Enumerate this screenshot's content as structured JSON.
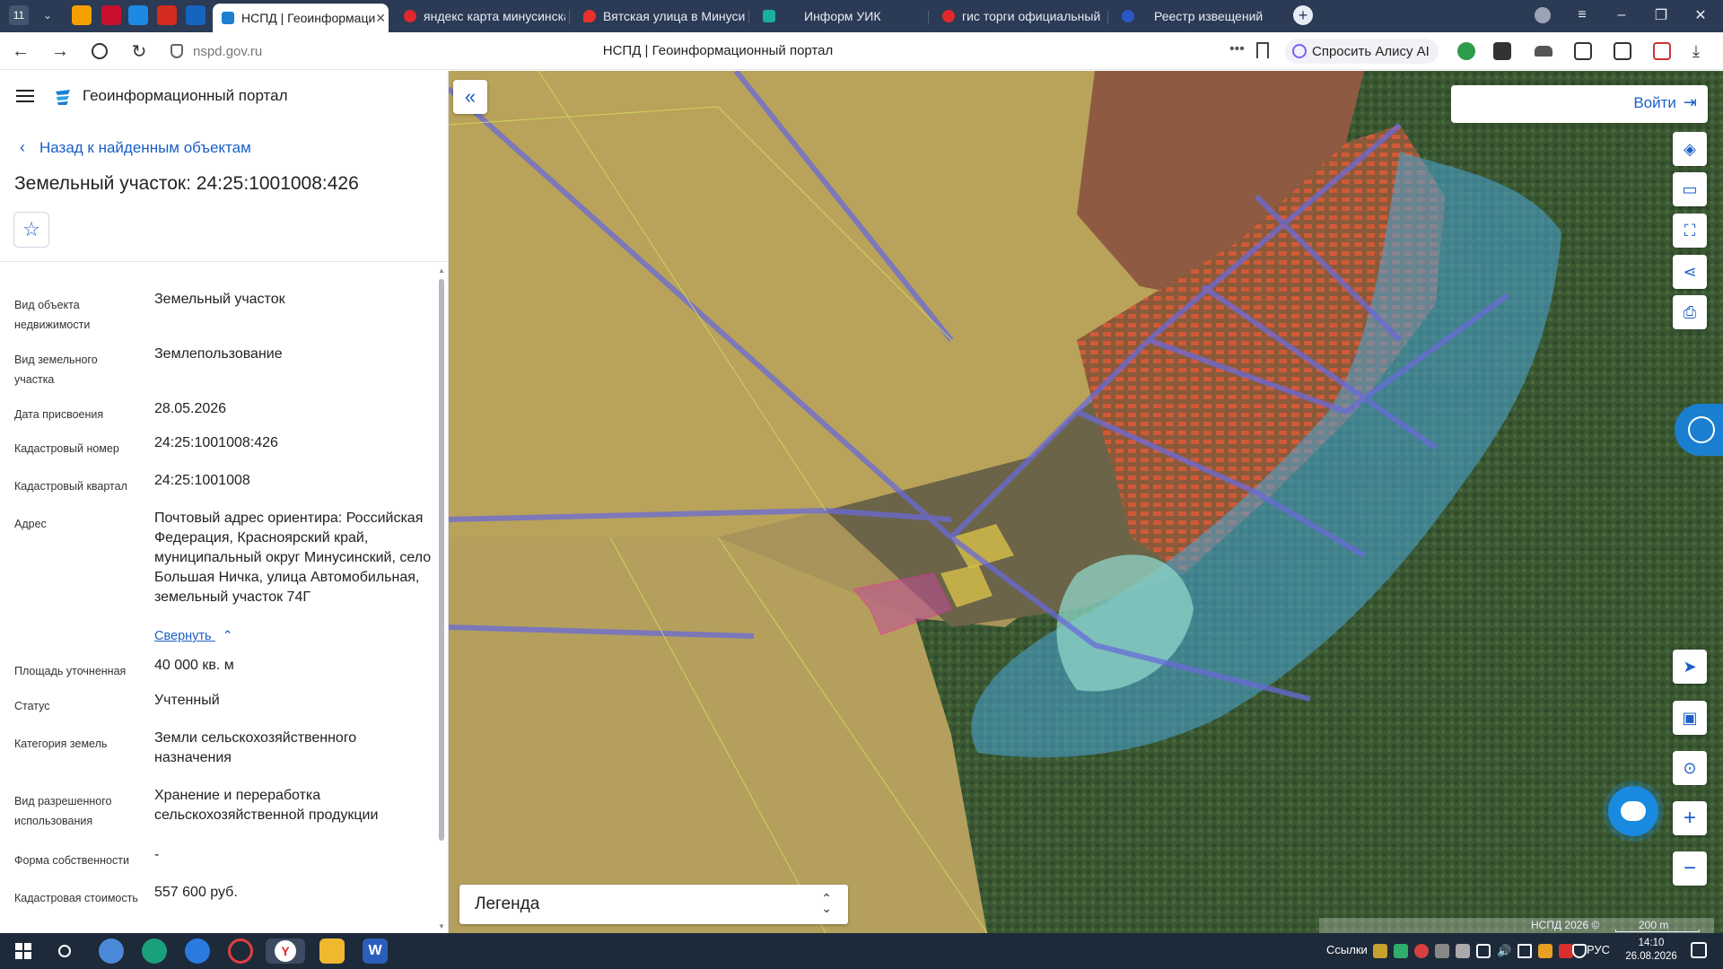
{
  "browser": {
    "tab_counter": "11",
    "tabs": [
      {
        "label": "НСПД | Геоинформаци",
        "close": "✕",
        "color": "#1a7fd1"
      },
      {
        "label": "яндекс карта минусинска",
        "color": "#e0292d"
      },
      {
        "label": "Вятская улица в Минусин",
        "color": "#e8302c"
      },
      {
        "label": "Информ УИК",
        "color": "#1ab0a0"
      },
      {
        "label": "гис торги официальный с",
        "color": "#e0292d"
      },
      {
        "label": "Реестр извещений",
        "color": "#2a56c6"
      }
    ],
    "new_tab": "+",
    "url": "nspd.gov.ru",
    "page_title": "НСПД | Геоинформационный портал",
    "alice_label": "Спросить Алису AI",
    "window": {
      "minimize": "–",
      "restore": "❐",
      "close": "✕",
      "menu": "≡"
    }
  },
  "sidebar": {
    "portal_name": "Геоинформационный портал",
    "back_label": "Назад к найденным объектам",
    "object_title": "Земельный участок: 24:25:1001008:426",
    "fav_icon": "☆",
    "collapse_label": "Свернуть",
    "properties": [
      {
        "label": "Вид объекта недвижимости",
        "value": "Земельный участок"
      },
      {
        "label": "Вид земельного участка",
        "value": "Землепользование"
      },
      {
        "label": "Дата присвоения",
        "value": "28.05.2026"
      },
      {
        "label": "Кадастровый номер",
        "value": "24:25:1001008:426"
      },
      {
        "label": "Кадастровый квартал",
        "value": "24:25:1001008"
      },
      {
        "label": "Адрес",
        "value": "Почтовый адрес ориентира: Российская Федерация, Красноярский край, муниципальный округ Минусинский, село Большая Ничка, улица Автомобильная, земельный участок 74Г"
      },
      {
        "label": "Площадь уточненная",
        "value": "40 000 кв. м"
      },
      {
        "label": "Статус",
        "value": "Учтенный"
      },
      {
        "label": "Категория земель",
        "value": "Земли сельскохозяйственного назначения"
      },
      {
        "label": "Вид разрешенного использования",
        "value": "Хранение и переработка сельскохозяйственной продукции"
      },
      {
        "label": "Форма собственности",
        "value": "-"
      },
      {
        "label": "Кадастровая стоимость",
        "value": "557 600 руб."
      }
    ]
  },
  "map": {
    "login_label": "Войти",
    "legend_label": "Легенда",
    "copyright": "НСПД 2026 ©",
    "scale_label": "200 m",
    "tools": [
      "layers-icon",
      "ruler-icon",
      "select-area-icon",
      "share-icon",
      "print-icon",
      "navigate-icon",
      "minimap-icon",
      "locate-icon",
      "zoom-in-icon",
      "zoom-out-icon"
    ]
  },
  "taskbar": {
    "links_label": "Ссылки",
    "lang": "РУС",
    "time": "14:10",
    "date": "26.08.2026"
  }
}
